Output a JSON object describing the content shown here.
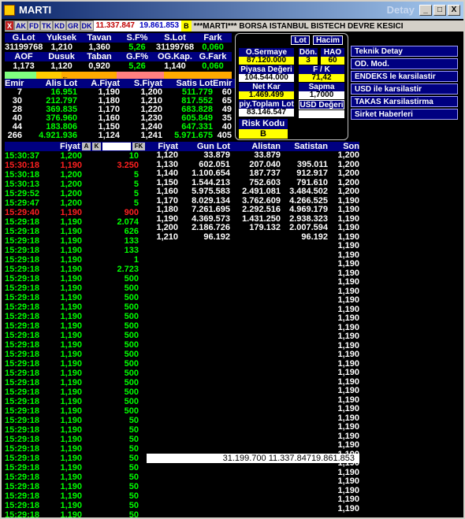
{
  "title": "MARTI",
  "detay": "Detay",
  "win_buttons": [
    "_",
    "□",
    "X"
  ],
  "toolbar": {
    "x": "X",
    "buttons": [
      "AK",
      "FD",
      "TK",
      "KD",
      "GR",
      "DK"
    ],
    "val1": "11.337.847",
    "val2": "19.861.853",
    "b": "B",
    "ticker": "***MARTI*** BORSA ISTANBUL BISTECH DEVRE KESICI"
  },
  "stats1": {
    "headers": [
      "G.Lot",
      "Yuksek",
      "Tavan",
      "S.F%",
      "S.Lot",
      "Fark"
    ],
    "values": [
      "31199768",
      "1,210",
      "1,360",
      "5,26",
      "31199768",
      "0,060"
    ]
  },
  "stats2": {
    "headers": [
      "AOF",
      "Dusuk",
      "Taban",
      "G.F%",
      "OG.Kap.",
      "G.Fark"
    ],
    "values": [
      "1,173",
      "1,120",
      "0,920",
      "5,26",
      "1,140",
      "0,060"
    ]
  },
  "arrow": "←",
  "orderbook": {
    "headers": [
      "Emir",
      "Alis Lot",
      "A.Fiyat",
      "S.Fiyat",
      "Satis Lot",
      "Emir"
    ],
    "rows": [
      [
        "7",
        "16.951",
        "1,190",
        "1,200",
        "511.779",
        "60"
      ],
      [
        "30",
        "212.797",
        "1,180",
        "1,210",
        "817.552",
        "65"
      ],
      [
        "28",
        "369.835",
        "1,170",
        "1,220",
        "683.828",
        "49"
      ],
      [
        "40",
        "376.960",
        "1,160",
        "1,230",
        "605.849",
        "35"
      ],
      [
        "44",
        "183.806",
        "1,150",
        "1,240",
        "647.331",
        "40"
      ],
      [
        "266",
        "4.921.936",
        "1,124",
        "1,241",
        "5.971.675",
        "405"
      ]
    ]
  },
  "panel": {
    "lot": "Lot",
    "hacim": "Hacim",
    "o_sermaye_label": "O.Sermaye",
    "o_sermaye": "87.120.000",
    "don_label": "Dön.",
    "don": "3",
    "hao_label": "HAO",
    "hao": "60",
    "piyasa_label": "Piyasa Değeri",
    "piyasa": "104.544.000",
    "fk_label": "F / K",
    "fk": "71,42",
    "netkar_label": "Net Kar",
    "netkar": "1.469.499",
    "sapma_label": "Sapma",
    "sapma": "1,7000",
    "ptoplam_label": "piy.Toplam Lot",
    "ptoplam": "83.146.547",
    "usd_label": "USD Değeri",
    "usd": "",
    "risk_label": "Risk Kodu",
    "risk": "B"
  },
  "menu": [
    "Teknik Detay",
    "OD. Mod.",
    "ENDEKS le karsilastir",
    "USD ile karsilastir",
    "TAKAS Karsilastirma",
    "Sirket Haberleri"
  ],
  "trades_header": {
    "fiyat": "Fiyat",
    "a": "A",
    "k": "K",
    "fk": "FK"
  },
  "trades": [
    [
      "15:30:37",
      "1,200",
      "10"
    ],
    [
      "15:30:18",
      "1,190",
      "3.250"
    ],
    [
      "15:30:18",
      "1,200",
      "5"
    ],
    [
      "15:30:13",
      "1,200",
      "5"
    ],
    [
      "15:29:52",
      "1,200",
      "5"
    ],
    [
      "15:29:47",
      "1,200",
      "5"
    ],
    [
      "15:29:40",
      "1,190",
      "900"
    ],
    [
      "15:29:18",
      "1,190",
      "2.074"
    ],
    [
      "15:29:18",
      "1,190",
      "626"
    ],
    [
      "15:29:18",
      "1,190",
      "133"
    ],
    [
      "15:29:18",
      "1,190",
      "133"
    ],
    [
      "15:29:18",
      "1,190",
      "1"
    ],
    [
      "15:29:18",
      "1,190",
      "2.723"
    ],
    [
      "15:29:18",
      "1,190",
      "500"
    ],
    [
      "15:29:18",
      "1,190",
      "500"
    ],
    [
      "15:29:18",
      "1,190",
      "500"
    ],
    [
      "15:29:18",
      "1,190",
      "500"
    ],
    [
      "15:29:18",
      "1,190",
      "500"
    ],
    [
      "15:29:18",
      "1,190",
      "500"
    ],
    [
      "15:29:18",
      "1,190",
      "500"
    ],
    [
      "15:29:18",
      "1,190",
      "500"
    ],
    [
      "15:29:18",
      "1,190",
      "500"
    ],
    [
      "15:29:18",
      "1,190",
      "500"
    ],
    [
      "15:29:18",
      "1,190",
      "500"
    ],
    [
      "15:29:18",
      "1,190",
      "500"
    ],
    [
      "15:29:18",
      "1,190",
      "500"
    ],
    [
      "15:29:18",
      "1,190",
      "500"
    ],
    [
      "15:29:18",
      "1,190",
      "500"
    ],
    [
      "15:29:18",
      "1,190",
      "50"
    ],
    [
      "15:29:18",
      "1,190",
      "50"
    ],
    [
      "15:29:18",
      "1,190",
      "50"
    ],
    [
      "15:29:18",
      "1,190",
      "50"
    ],
    [
      "15:29:18",
      "1,190",
      "50"
    ],
    [
      "15:29:18",
      "1,190",
      "50"
    ],
    [
      "15:29:18",
      "1,190",
      "50"
    ],
    [
      "15:29:18",
      "1,190",
      "50"
    ],
    [
      "15:29:18",
      "1,190",
      "50"
    ],
    [
      "15:29:18",
      "1,190",
      "50"
    ],
    [
      "15:29:18",
      "1,190",
      "50"
    ],
    [
      "15:29:18",
      "1,190",
      "50"
    ]
  ],
  "trade_colors": [
    "g",
    "r",
    "g",
    "g",
    "g",
    "g",
    "r",
    "g",
    "g",
    "g",
    "g",
    "g",
    "g",
    "g",
    "g",
    "g",
    "g",
    "g",
    "g",
    "g",
    "g",
    "g",
    "g",
    "g",
    "g",
    "g",
    "g",
    "g",
    "g",
    "g",
    "g",
    "g",
    "g",
    "g",
    "g",
    "g",
    "g",
    "g",
    "g",
    "g"
  ],
  "dist_header": [
    "Fiyat",
    "Gun Lot",
    "Alistan",
    "Satistan",
    "Son"
  ],
  "dist": [
    [
      "1,120",
      "33.879",
      "33.879",
      "",
      "1,200"
    ],
    [
      "1,130",
      "602.051",
      "207.040",
      "395.011",
      "1,200"
    ],
    [
      "1,140",
      "1.100.654",
      "187.737",
      "912.917",
      "1,200"
    ],
    [
      "1,150",
      "1.544.213",
      "752.603",
      "791.610",
      "1,200"
    ],
    [
      "1,160",
      "5.975.583",
      "2.491.081",
      "3.484.502",
      "1,200"
    ],
    [
      "1,170",
      "8.029.134",
      "3.762.609",
      "4.266.525",
      "1,190"
    ],
    [
      "1,180",
      "7.261.695",
      "2.292.516",
      "4.969.179",
      "1,190"
    ],
    [
      "1,190",
      "4.369.573",
      "1.431.250",
      "2.938.323",
      "1,190"
    ],
    [
      "1,200",
      "2.186.726",
      "179.132",
      "2.007.594",
      "1,190"
    ],
    [
      "1,210",
      "96.192",
      "",
      "96.192",
      "1,190"
    ]
  ],
  "son_extra": [
    "1,190",
    "1,190",
    "1,190",
    "1,190",
    "1,190",
    "1,190",
    "1,190",
    "1,190",
    "1,190",
    "1,190",
    "1,190",
    "1,190",
    "1,190",
    "1,190",
    "1,190",
    "1,190",
    "1,190",
    "1,190",
    "1,190",
    "1,190",
    "1,190",
    "1,190",
    "1,190",
    "1,190",
    "1,190",
    "1,190",
    "1,190",
    "1,190",
    "1,190",
    "1,190"
  ],
  "totals": "31.199.700 11.337.84719.861.853"
}
